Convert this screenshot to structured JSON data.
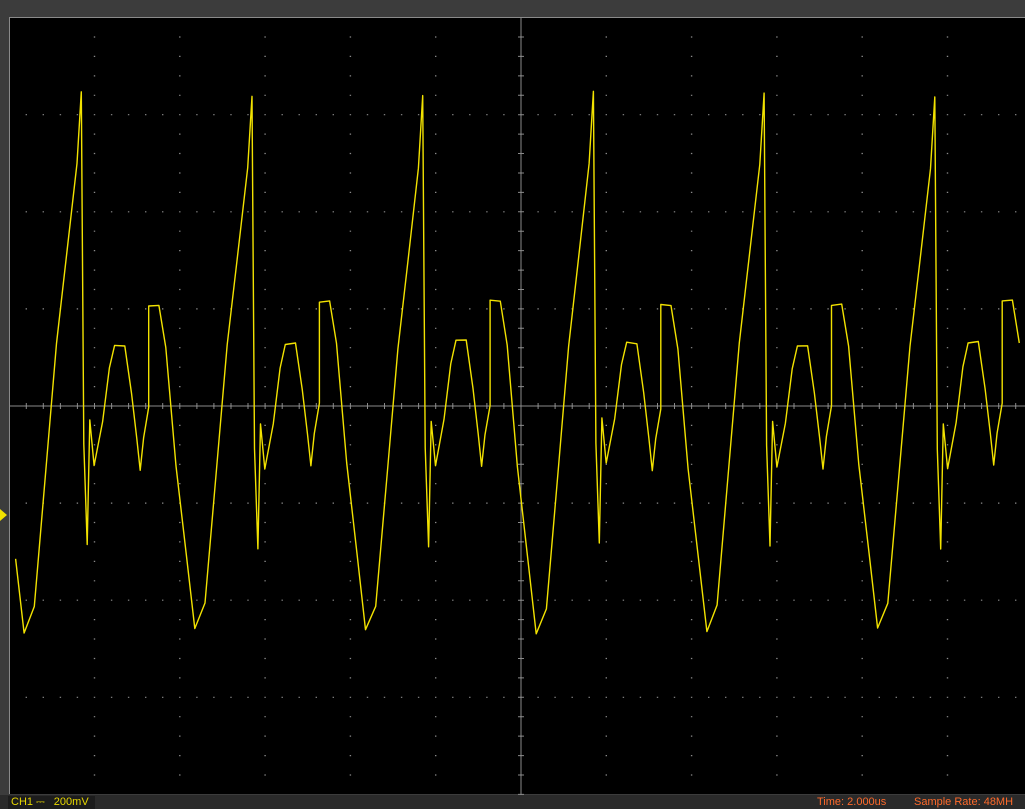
{
  "channel": {
    "label": "CH1",
    "coupling_icon": "dc-coupling-icon",
    "coupling_symbol": "⎓",
    "volts_per_div": "200mV",
    "trace_color": "#f2e200"
  },
  "status": {
    "time_label": "Time: 2.000us",
    "sample_rate_label": "Sample Rate: 48MH"
  },
  "colors": {
    "grid": "#8a8a8a",
    "background": "#000000",
    "status_text": "#ff6a2a"
  }
}
